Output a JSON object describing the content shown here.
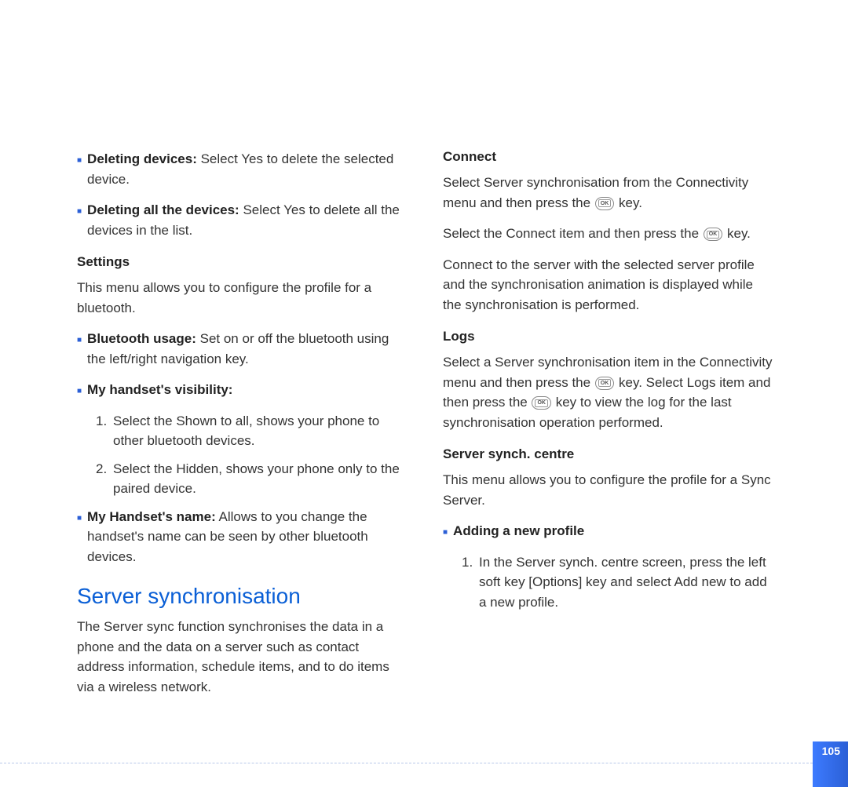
{
  "pageNumber": "105",
  "left": {
    "bullets_top": [
      {
        "label": "Deleting devices:",
        "text": " Select Yes to delete the selected device."
      },
      {
        "label": "Deleting all the devices:",
        "text": " Select Yes to delete all the devices in the list."
      }
    ],
    "settings": {
      "heading": "Settings",
      "intro": "This menu allows you to configure the profile for a bluetooth.",
      "bt_usage": {
        "label": "Bluetooth usage:",
        "text": " Set on or off the bluetooth using the left/right navigation key."
      },
      "visibility": {
        "label": "My handset's visibility:",
        "items": [
          "Select the Shown to all, shows your phone to other bluetooth devices.",
          "Select the Hidden, shows your phone only to the paired device."
        ]
      },
      "handset_name": {
        "label": "My Handset's name:",
        "text": " Allows to you change the handset's name can be seen by other bluetooth devices."
      }
    },
    "server_sync": {
      "title": "Server synchronisation",
      "para": "The Server sync function synchronises the data in a phone and the data on a server such as contact address information, schedule items, and to do items via a wireless network."
    }
  },
  "right": {
    "connect": {
      "heading": "Connect",
      "p1a": "Select Server synchronisation from the Connectivity menu and then press the ",
      "p1b": " key.",
      "p2a": "Select the Connect item and then press the ",
      "p2b": " key.",
      "p3": "Connect to the server with the selected server profile and the synchronisation animation is displayed while the synchronisation is performed."
    },
    "logs": {
      "heading": "Logs",
      "p1a": "Select a Server synchronisation item in the Connectivity menu and then press the ",
      "p1b": " key. Select Logs item and then press the ",
      "p1c": " key to view the log for the last synchronisation operation performed."
    },
    "centre": {
      "heading": "Server synch. centre",
      "intro": "This menu allows you to configure the profile for a Sync Server.",
      "adding": {
        "label": "Adding a new profile",
        "items": [
          "In the Server synch. centre screen, press the left soft key [Options] key and select Add new to add a new profile."
        ]
      }
    }
  },
  "ok": "OK"
}
